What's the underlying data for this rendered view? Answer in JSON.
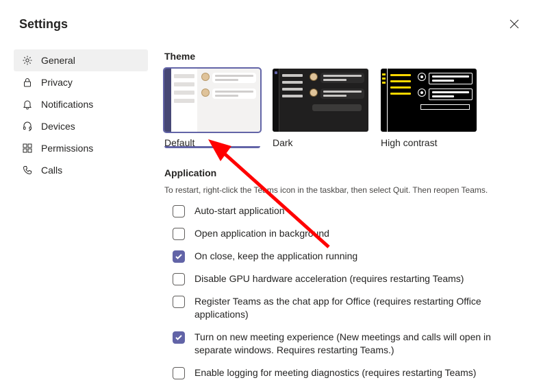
{
  "header": {
    "title": "Settings"
  },
  "sidebar": {
    "items": [
      {
        "label": "General",
        "icon": "gear-icon",
        "active": true
      },
      {
        "label": "Privacy",
        "icon": "lock-icon",
        "active": false
      },
      {
        "label": "Notifications",
        "icon": "bell-icon",
        "active": false
      },
      {
        "label": "Devices",
        "icon": "headset-icon",
        "active": false
      },
      {
        "label": "Permissions",
        "icon": "permissions-icon",
        "active": false
      },
      {
        "label": "Calls",
        "icon": "phone-icon",
        "active": false
      }
    ]
  },
  "theme": {
    "heading": "Theme",
    "options": [
      {
        "label": "Default",
        "selected": true
      },
      {
        "label": "Dark",
        "selected": false
      },
      {
        "label": "High contrast",
        "selected": false
      }
    ]
  },
  "application": {
    "heading": "Application",
    "note": "To restart, right-click the Teams icon in the taskbar, then select Quit. Then reopen Teams.",
    "options": [
      {
        "label": "Auto-start application",
        "checked": false
      },
      {
        "label": "Open application in background",
        "checked": false
      },
      {
        "label": "On close, keep the application running",
        "checked": true
      },
      {
        "label": "Disable GPU hardware acceleration (requires restarting Teams)",
        "checked": false
      },
      {
        "label": "Register Teams as the chat app for Office (requires restarting Office applications)",
        "checked": false
      },
      {
        "label": "Turn on new meeting experience (New meetings and calls will open in separate windows. Requires restarting Teams.)",
        "checked": true
      },
      {
        "label": "Enable logging for meeting diagnostics (requires restarting Teams)",
        "checked": false
      }
    ]
  },
  "colors": {
    "accent": "#6264a7"
  }
}
